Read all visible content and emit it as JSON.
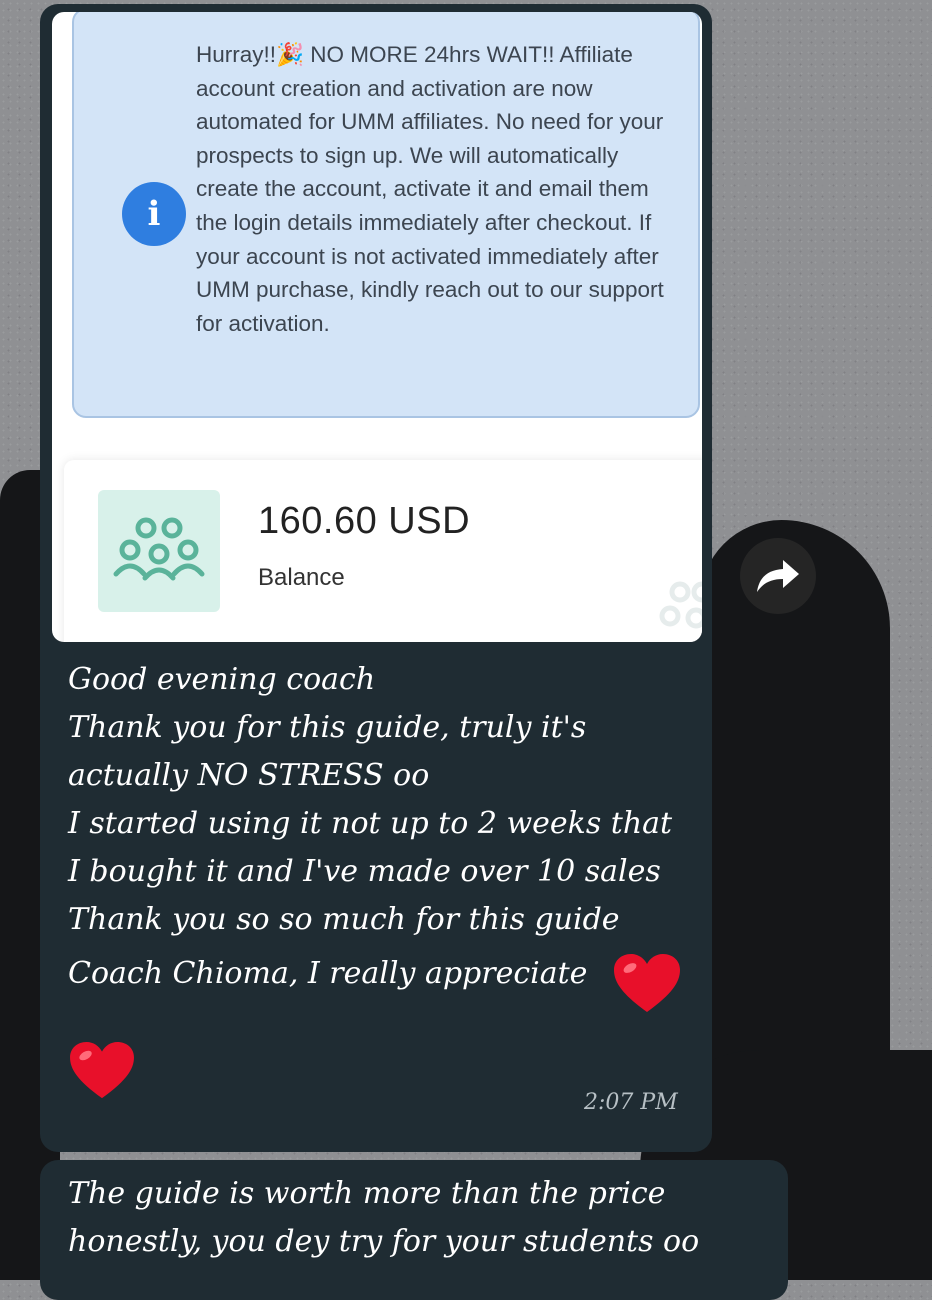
{
  "image_card": {
    "info_text": "Hurray!!🎉 NO MORE 24hrs WAIT!! Affiliate account creation and activation are now automated for UMM affiliates. No need for your prospects to sign up. We will automatically create the account, activate it and email them the login details immediately after checkout. If your account is not activated immediately after UMM purchase, kindly reach out to our support for activation.",
    "info_icon": "info-icon",
    "balance_amount": "160.60 USD",
    "balance_label": "Balance",
    "balance_icon": "users-group-icon"
  },
  "message": {
    "lines": "Good evening coach\nThank you for this guide, truly it's\nactually NO STRESS oo\nI started using it not up to 2 weeks that\nI bought it and I've made over 10 sales\nThank you so so much for this guide",
    "line_appreciate": "Coach Chioma, I really appreciate",
    "timestamp": "2:07 PM",
    "emojis": [
      "red-heart-icon",
      "red-heart-icon"
    ]
  },
  "message2": {
    "text": "The guide is worth more than the price\nhonestly, you dey try for your students oo"
  },
  "forward_icon": "forward-arrow-icon",
  "colors": {
    "bubble": "#1f2c33",
    "info_bg": "#d3e4f7",
    "info_icon": "#2f7ee0",
    "balance_icon_bg": "#d8f1ea",
    "balance_icon": "#5ab39a",
    "heart": "#e8102a"
  }
}
